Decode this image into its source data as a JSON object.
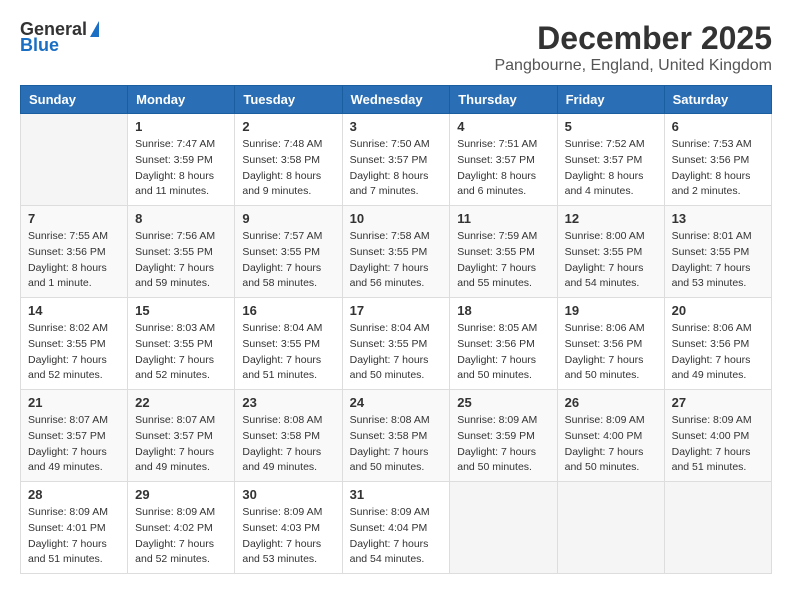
{
  "logo": {
    "general": "General",
    "blue": "Blue"
  },
  "title": "December 2025",
  "location": "Pangbourne, England, United Kingdom",
  "days_of_week": [
    "Sunday",
    "Monday",
    "Tuesday",
    "Wednesday",
    "Thursday",
    "Friday",
    "Saturday"
  ],
  "weeks": [
    [
      {
        "day": "",
        "info": ""
      },
      {
        "day": "1",
        "info": "Sunrise: 7:47 AM\nSunset: 3:59 PM\nDaylight: 8 hours\nand 11 minutes."
      },
      {
        "day": "2",
        "info": "Sunrise: 7:48 AM\nSunset: 3:58 PM\nDaylight: 8 hours\nand 9 minutes."
      },
      {
        "day": "3",
        "info": "Sunrise: 7:50 AM\nSunset: 3:57 PM\nDaylight: 8 hours\nand 7 minutes."
      },
      {
        "day": "4",
        "info": "Sunrise: 7:51 AM\nSunset: 3:57 PM\nDaylight: 8 hours\nand 6 minutes."
      },
      {
        "day": "5",
        "info": "Sunrise: 7:52 AM\nSunset: 3:57 PM\nDaylight: 8 hours\nand 4 minutes."
      },
      {
        "day": "6",
        "info": "Sunrise: 7:53 AM\nSunset: 3:56 PM\nDaylight: 8 hours\nand 2 minutes."
      }
    ],
    [
      {
        "day": "7",
        "info": "Sunrise: 7:55 AM\nSunset: 3:56 PM\nDaylight: 8 hours\nand 1 minute."
      },
      {
        "day": "8",
        "info": "Sunrise: 7:56 AM\nSunset: 3:55 PM\nDaylight: 7 hours\nand 59 minutes."
      },
      {
        "day": "9",
        "info": "Sunrise: 7:57 AM\nSunset: 3:55 PM\nDaylight: 7 hours\nand 58 minutes."
      },
      {
        "day": "10",
        "info": "Sunrise: 7:58 AM\nSunset: 3:55 PM\nDaylight: 7 hours\nand 56 minutes."
      },
      {
        "day": "11",
        "info": "Sunrise: 7:59 AM\nSunset: 3:55 PM\nDaylight: 7 hours\nand 55 minutes."
      },
      {
        "day": "12",
        "info": "Sunrise: 8:00 AM\nSunset: 3:55 PM\nDaylight: 7 hours\nand 54 minutes."
      },
      {
        "day": "13",
        "info": "Sunrise: 8:01 AM\nSunset: 3:55 PM\nDaylight: 7 hours\nand 53 minutes."
      }
    ],
    [
      {
        "day": "14",
        "info": "Sunrise: 8:02 AM\nSunset: 3:55 PM\nDaylight: 7 hours\nand 52 minutes."
      },
      {
        "day": "15",
        "info": "Sunrise: 8:03 AM\nSunset: 3:55 PM\nDaylight: 7 hours\nand 52 minutes."
      },
      {
        "day": "16",
        "info": "Sunrise: 8:04 AM\nSunset: 3:55 PM\nDaylight: 7 hours\nand 51 minutes."
      },
      {
        "day": "17",
        "info": "Sunrise: 8:04 AM\nSunset: 3:55 PM\nDaylight: 7 hours\nand 50 minutes."
      },
      {
        "day": "18",
        "info": "Sunrise: 8:05 AM\nSunset: 3:56 PM\nDaylight: 7 hours\nand 50 minutes."
      },
      {
        "day": "19",
        "info": "Sunrise: 8:06 AM\nSunset: 3:56 PM\nDaylight: 7 hours\nand 50 minutes."
      },
      {
        "day": "20",
        "info": "Sunrise: 8:06 AM\nSunset: 3:56 PM\nDaylight: 7 hours\nand 49 minutes."
      }
    ],
    [
      {
        "day": "21",
        "info": "Sunrise: 8:07 AM\nSunset: 3:57 PM\nDaylight: 7 hours\nand 49 minutes."
      },
      {
        "day": "22",
        "info": "Sunrise: 8:07 AM\nSunset: 3:57 PM\nDaylight: 7 hours\nand 49 minutes."
      },
      {
        "day": "23",
        "info": "Sunrise: 8:08 AM\nSunset: 3:58 PM\nDaylight: 7 hours\nand 49 minutes."
      },
      {
        "day": "24",
        "info": "Sunrise: 8:08 AM\nSunset: 3:58 PM\nDaylight: 7 hours\nand 50 minutes."
      },
      {
        "day": "25",
        "info": "Sunrise: 8:09 AM\nSunset: 3:59 PM\nDaylight: 7 hours\nand 50 minutes."
      },
      {
        "day": "26",
        "info": "Sunrise: 8:09 AM\nSunset: 4:00 PM\nDaylight: 7 hours\nand 50 minutes."
      },
      {
        "day": "27",
        "info": "Sunrise: 8:09 AM\nSunset: 4:00 PM\nDaylight: 7 hours\nand 51 minutes."
      }
    ],
    [
      {
        "day": "28",
        "info": "Sunrise: 8:09 AM\nSunset: 4:01 PM\nDaylight: 7 hours\nand 51 minutes."
      },
      {
        "day": "29",
        "info": "Sunrise: 8:09 AM\nSunset: 4:02 PM\nDaylight: 7 hours\nand 52 minutes."
      },
      {
        "day": "30",
        "info": "Sunrise: 8:09 AM\nSunset: 4:03 PM\nDaylight: 7 hours\nand 53 minutes."
      },
      {
        "day": "31",
        "info": "Sunrise: 8:09 AM\nSunset: 4:04 PM\nDaylight: 7 hours\nand 54 minutes."
      },
      {
        "day": "",
        "info": ""
      },
      {
        "day": "",
        "info": ""
      },
      {
        "day": "",
        "info": ""
      }
    ]
  ],
  "colors": {
    "header_bg": "#2a6eb5",
    "header_text": "#ffffff",
    "title_text": "#333333",
    "location_text": "#555555"
  }
}
